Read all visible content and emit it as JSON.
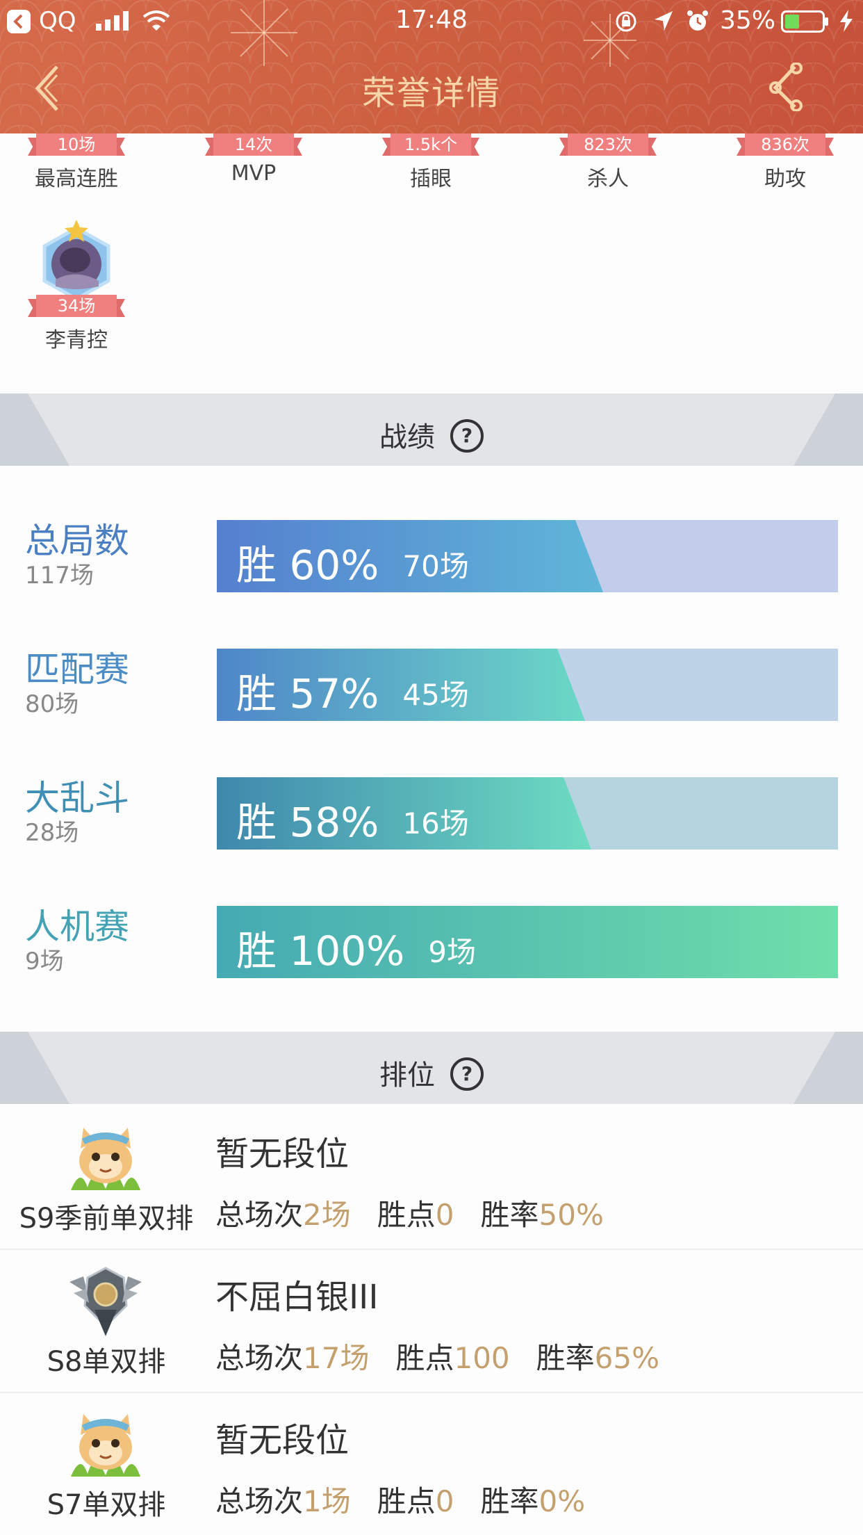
{
  "status_bar": {
    "back_app": "QQ",
    "time": "17:48",
    "battery_pct": "35%"
  },
  "nav": {
    "title": "荣誉详情"
  },
  "honors": [
    {
      "value": "10场",
      "label": "最高连胜"
    },
    {
      "value": "14次",
      "label": "MVP"
    },
    {
      "value": "1.5k个",
      "label": "插眼"
    },
    {
      "value": "823次",
      "label": "杀人"
    },
    {
      "value": "836次",
      "label": "助攻"
    }
  ],
  "champion": {
    "value": "34场",
    "label": "李青控"
  },
  "record": {
    "title": "战绩",
    "help": "?",
    "rows": [
      {
        "name": "总局数",
        "count": "117场",
        "win_prefix": "胜",
        "pct_text": "60%",
        "games": "70场",
        "win_rate": 0.6,
        "name_color": "#4a7fc4",
        "grad": [
          "#5580cf",
          "#5fb6d8"
        ],
        "track": "#c1cdea"
      },
      {
        "name": "匹配赛",
        "count": "80场",
        "win_prefix": "胜",
        "pct_text": "57%",
        "games": "45场",
        "win_rate": 0.57,
        "name_color": "#4b8cc4",
        "grad": [
          "#4f86c9",
          "#6bd8c6"
        ],
        "track": "#bed2e8"
      },
      {
        "name": "大乱斗",
        "count": "28场",
        "win_prefix": "胜",
        "pct_text": "58%",
        "games": "16场",
        "win_rate": 0.58,
        "name_color": "#3f8fb5",
        "grad": [
          "#3f88ad",
          "#6edcc2"
        ],
        "track": "#b6d4e0"
      },
      {
        "name": "人机赛",
        "count": "9场",
        "win_prefix": "胜",
        "pct_text": "100%",
        "games": "9场",
        "win_rate": 1.0,
        "name_color": "#43a2b3",
        "grad": [
          "#45aab3",
          "#70deaa"
        ],
        "track": "#b8e0d2"
      }
    ]
  },
  "ranked": {
    "title": "排位",
    "help": "?",
    "stat_labels": {
      "total": "总场次",
      "points": "胜点",
      "rate": "胜率"
    },
    "rows": [
      {
        "season": "S9季前单双排",
        "tier": "暂无段位",
        "total": "2场",
        "points": "0",
        "rate": "50%",
        "icon": "unranked-cat-icon"
      },
      {
        "season": "S8单双排",
        "tier": "不屈白银III",
        "total": "17场",
        "points": "100",
        "rate": "65%",
        "icon": "silver-rank-icon"
      },
      {
        "season": "S7单双排",
        "tier": "暂无段位",
        "total": "1场",
        "points": "0",
        "rate": "0%",
        "icon": "unranked-cat-icon"
      }
    ]
  }
}
